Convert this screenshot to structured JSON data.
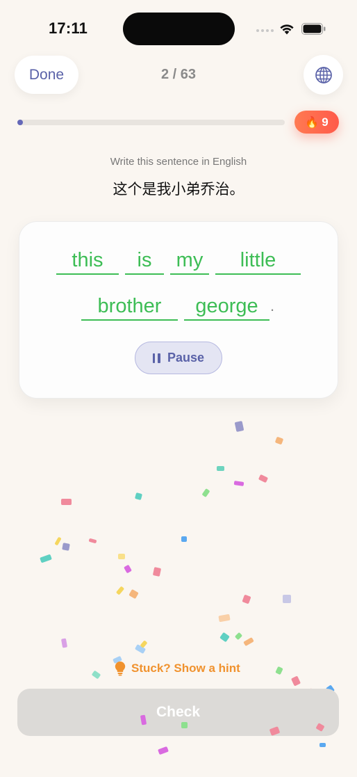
{
  "status_bar": {
    "time": "17:11"
  },
  "header": {
    "done_label": "Done",
    "counter": "2 / 63",
    "globe_icon": "globe-icon"
  },
  "progress": {
    "fraction": 0.02,
    "streak_icon": "flame",
    "streak_count": "9"
  },
  "prompt": {
    "instruction": "Write this sentence in English",
    "sentence": "这个是我小弟乔治。"
  },
  "answer": {
    "words": [
      "this",
      "is",
      "my",
      "little",
      "brother",
      "george"
    ],
    "punctuation": ".",
    "pause_label": "Pause"
  },
  "hint": {
    "label": "Stuck? Show a hint",
    "icon": "lightbulb-icon"
  },
  "check": {
    "label": "Check"
  },
  "colors": {
    "accent": "#5a62a8",
    "correct": "#3dbd55",
    "hint": "#f0922e",
    "streak": "#ff6a4e"
  }
}
